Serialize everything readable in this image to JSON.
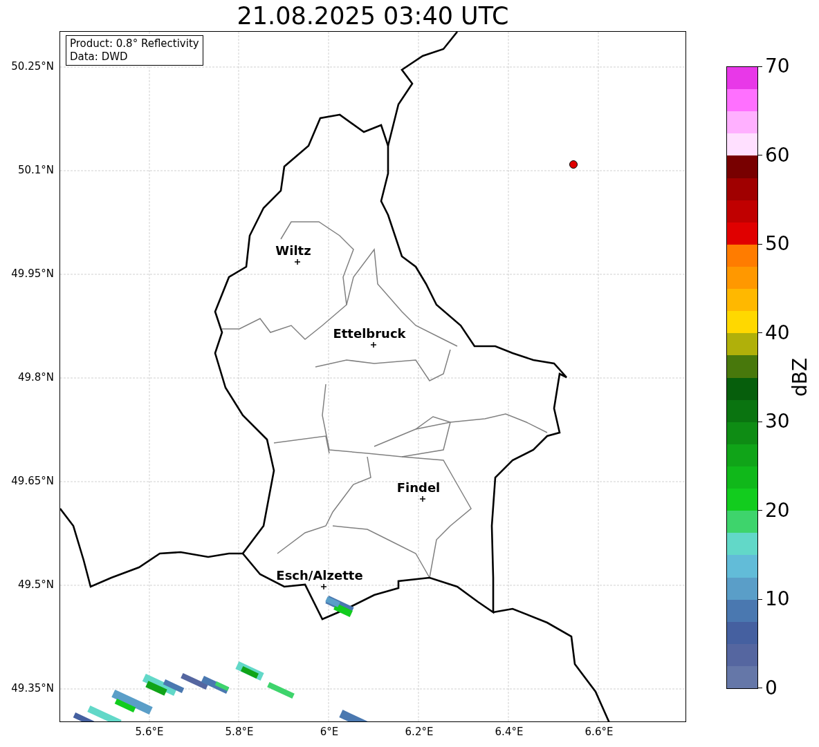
{
  "title": "21.08.2025 03:40 UTC",
  "info_box": [
    "Product: 0.8° Reflectivity",
    "Data: DWD"
  ],
  "map": {
    "y_ticks": [
      "50.25°N",
      "50.1°N",
      "49.95°N",
      "49.8°N",
      "49.65°N",
      "49.5°N",
      "49.35°N"
    ],
    "x_ticks": [
      "5.6°E",
      "5.8°E",
      "6°E",
      "6.2°E",
      "6.4°E",
      "6.6°E"
    ],
    "cities": [
      {
        "name": "Wiltz"
      },
      {
        "name": "Ettelbruck"
      },
      {
        "name": "Findel"
      },
      {
        "name": "Esch/Alzette"
      }
    ]
  },
  "colorbar": {
    "label": "dBZ",
    "ticks": [
      "70",
      "60",
      "50",
      "40",
      "30",
      "20",
      "10",
      "0"
    ],
    "segments": [
      {
        "color": "#e838e8"
      },
      {
        "color": "#ff70ff"
      },
      {
        "color": "#ffb0ff"
      },
      {
        "color": "#ffe0ff"
      },
      {
        "color": "#780000"
      },
      {
        "color": "#a00000"
      },
      {
        "color": "#c00000"
      },
      {
        "color": "#e00000"
      },
      {
        "color": "#ff7c00"
      },
      {
        "color": "#ff9800"
      },
      {
        "color": "#ffb800"
      },
      {
        "color": "#ffd800"
      },
      {
        "color": "#b0b00a"
      },
      {
        "color": "#48780c"
      },
      {
        "color": "#065e0c"
      },
      {
        "color": "#0a7410"
      },
      {
        "color": "#0e8c14"
      },
      {
        "color": "#10a418"
      },
      {
        "color": "#10b81a"
      },
      {
        "color": "#12cc1e"
      },
      {
        "color": "#3ed46c"
      },
      {
        "color": "#62d8c8"
      },
      {
        "color": "#62bcd8"
      },
      {
        "color": "#5a9ec8"
      },
      {
        "color": "#4a78b0"
      },
      {
        "color": "#4560a0"
      },
      {
        "color": "#5566a0"
      },
      {
        "color": "#6577a8"
      }
    ]
  }
}
